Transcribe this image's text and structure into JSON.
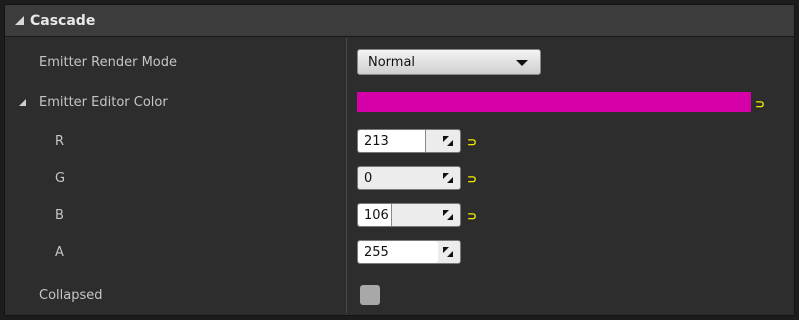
{
  "section": {
    "title": "Cascade"
  },
  "properties": {
    "render_mode": {
      "label": "Emitter Render Mode",
      "value": "Normal"
    },
    "editor_color": {
      "label": "Emitter Editor Color",
      "color": "#d500a8"
    },
    "channels": [
      {
        "label": "R",
        "value": "213",
        "fraction": 0.835
      },
      {
        "label": "G",
        "value": "0",
        "fraction": 0.0
      },
      {
        "label": "B",
        "value": "106",
        "fraction": 0.416
      },
      {
        "label": "A",
        "value": "255",
        "fraction": 1.0
      }
    ],
    "collapsed": {
      "label": "Collapsed",
      "checked": false
    }
  },
  "icons": {
    "section_expand": "expanded-triangle-icon",
    "reset": "reset-to-default-icon",
    "resize": "drag-resize-icon",
    "dropdown": "chevron-down-icon"
  }
}
